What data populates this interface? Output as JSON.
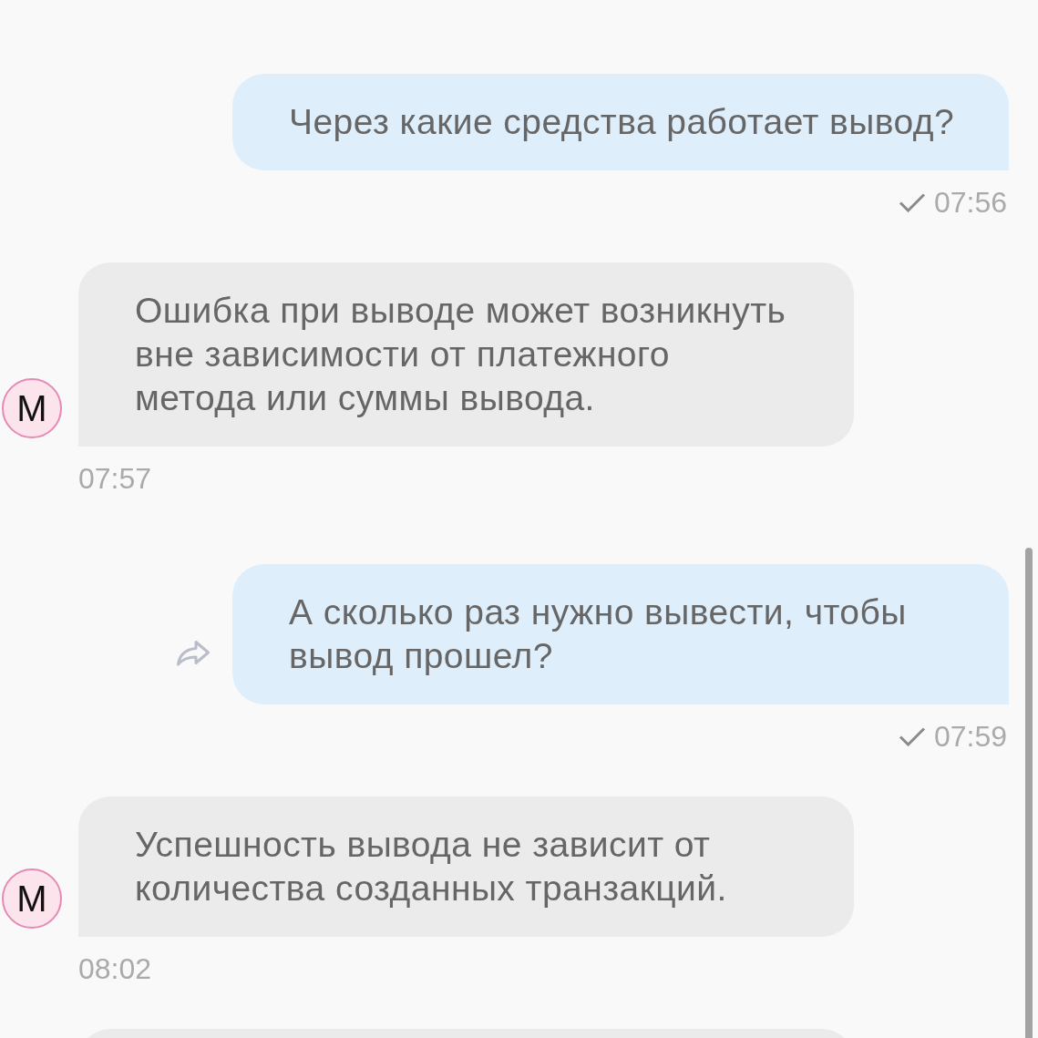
{
  "messages": [
    {
      "kind": "outgoing",
      "text": "Через какие средства работает вывод?",
      "time": "07:56",
      "sent": true,
      "forward_icon": false
    },
    {
      "kind": "incoming",
      "avatar": "M",
      "text": "Ошибка при выводе может возникнуть\nвне зависимости от платежного\nметода или суммы вывода.",
      "time": "07:57"
    },
    {
      "kind": "outgoing",
      "text": "А сколько раз нужно вывести, чтобы\nвывод прошел?",
      "time": "07:59",
      "sent": true,
      "forward_icon": true
    },
    {
      "kind": "incoming",
      "avatar": "M",
      "text": "Успешность вывода не зависит от\nколичества созданных транзакций.",
      "time": "08:02"
    },
    {
      "kind": "incoming"
    }
  ]
}
